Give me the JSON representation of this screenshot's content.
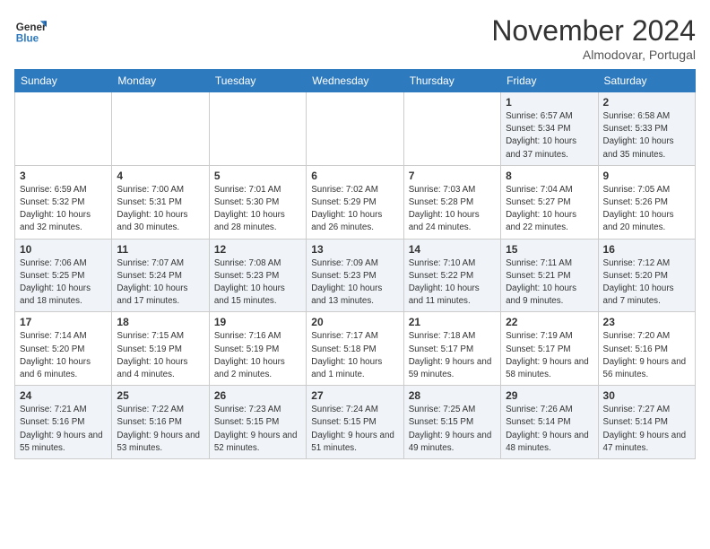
{
  "header": {
    "logo_line1": "General",
    "logo_line2": "Blue",
    "month": "November 2024",
    "location": "Almodovar, Portugal"
  },
  "weekdays": [
    "Sunday",
    "Monday",
    "Tuesday",
    "Wednesday",
    "Thursday",
    "Friday",
    "Saturday"
  ],
  "weeks": [
    [
      {
        "day": "",
        "info": ""
      },
      {
        "day": "",
        "info": ""
      },
      {
        "day": "",
        "info": ""
      },
      {
        "day": "",
        "info": ""
      },
      {
        "day": "",
        "info": ""
      },
      {
        "day": "1",
        "info": "Sunrise: 6:57 AM\nSunset: 5:34 PM\nDaylight: 10 hours and 37 minutes."
      },
      {
        "day": "2",
        "info": "Sunrise: 6:58 AM\nSunset: 5:33 PM\nDaylight: 10 hours and 35 minutes."
      }
    ],
    [
      {
        "day": "3",
        "info": "Sunrise: 6:59 AM\nSunset: 5:32 PM\nDaylight: 10 hours and 32 minutes."
      },
      {
        "day": "4",
        "info": "Sunrise: 7:00 AM\nSunset: 5:31 PM\nDaylight: 10 hours and 30 minutes."
      },
      {
        "day": "5",
        "info": "Sunrise: 7:01 AM\nSunset: 5:30 PM\nDaylight: 10 hours and 28 minutes."
      },
      {
        "day": "6",
        "info": "Sunrise: 7:02 AM\nSunset: 5:29 PM\nDaylight: 10 hours and 26 minutes."
      },
      {
        "day": "7",
        "info": "Sunrise: 7:03 AM\nSunset: 5:28 PM\nDaylight: 10 hours and 24 minutes."
      },
      {
        "day": "8",
        "info": "Sunrise: 7:04 AM\nSunset: 5:27 PM\nDaylight: 10 hours and 22 minutes."
      },
      {
        "day": "9",
        "info": "Sunrise: 7:05 AM\nSunset: 5:26 PM\nDaylight: 10 hours and 20 minutes."
      }
    ],
    [
      {
        "day": "10",
        "info": "Sunrise: 7:06 AM\nSunset: 5:25 PM\nDaylight: 10 hours and 18 minutes."
      },
      {
        "day": "11",
        "info": "Sunrise: 7:07 AM\nSunset: 5:24 PM\nDaylight: 10 hours and 17 minutes."
      },
      {
        "day": "12",
        "info": "Sunrise: 7:08 AM\nSunset: 5:23 PM\nDaylight: 10 hours and 15 minutes."
      },
      {
        "day": "13",
        "info": "Sunrise: 7:09 AM\nSunset: 5:23 PM\nDaylight: 10 hours and 13 minutes."
      },
      {
        "day": "14",
        "info": "Sunrise: 7:10 AM\nSunset: 5:22 PM\nDaylight: 10 hours and 11 minutes."
      },
      {
        "day": "15",
        "info": "Sunrise: 7:11 AM\nSunset: 5:21 PM\nDaylight: 10 hours and 9 minutes."
      },
      {
        "day": "16",
        "info": "Sunrise: 7:12 AM\nSunset: 5:20 PM\nDaylight: 10 hours and 7 minutes."
      }
    ],
    [
      {
        "day": "17",
        "info": "Sunrise: 7:14 AM\nSunset: 5:20 PM\nDaylight: 10 hours and 6 minutes."
      },
      {
        "day": "18",
        "info": "Sunrise: 7:15 AM\nSunset: 5:19 PM\nDaylight: 10 hours and 4 minutes."
      },
      {
        "day": "19",
        "info": "Sunrise: 7:16 AM\nSunset: 5:19 PM\nDaylight: 10 hours and 2 minutes."
      },
      {
        "day": "20",
        "info": "Sunrise: 7:17 AM\nSunset: 5:18 PM\nDaylight: 10 hours and 1 minute."
      },
      {
        "day": "21",
        "info": "Sunrise: 7:18 AM\nSunset: 5:17 PM\nDaylight: 9 hours and 59 minutes."
      },
      {
        "day": "22",
        "info": "Sunrise: 7:19 AM\nSunset: 5:17 PM\nDaylight: 9 hours and 58 minutes."
      },
      {
        "day": "23",
        "info": "Sunrise: 7:20 AM\nSunset: 5:16 PM\nDaylight: 9 hours and 56 minutes."
      }
    ],
    [
      {
        "day": "24",
        "info": "Sunrise: 7:21 AM\nSunset: 5:16 PM\nDaylight: 9 hours and 55 minutes."
      },
      {
        "day": "25",
        "info": "Sunrise: 7:22 AM\nSunset: 5:16 PM\nDaylight: 9 hours and 53 minutes."
      },
      {
        "day": "26",
        "info": "Sunrise: 7:23 AM\nSunset: 5:15 PM\nDaylight: 9 hours and 52 minutes."
      },
      {
        "day": "27",
        "info": "Sunrise: 7:24 AM\nSunset: 5:15 PM\nDaylight: 9 hours and 51 minutes."
      },
      {
        "day": "28",
        "info": "Sunrise: 7:25 AM\nSunset: 5:15 PM\nDaylight: 9 hours and 49 minutes."
      },
      {
        "day": "29",
        "info": "Sunrise: 7:26 AM\nSunset: 5:14 PM\nDaylight: 9 hours and 48 minutes."
      },
      {
        "day": "30",
        "info": "Sunrise: 7:27 AM\nSunset: 5:14 PM\nDaylight: 9 hours and 47 minutes."
      }
    ]
  ]
}
